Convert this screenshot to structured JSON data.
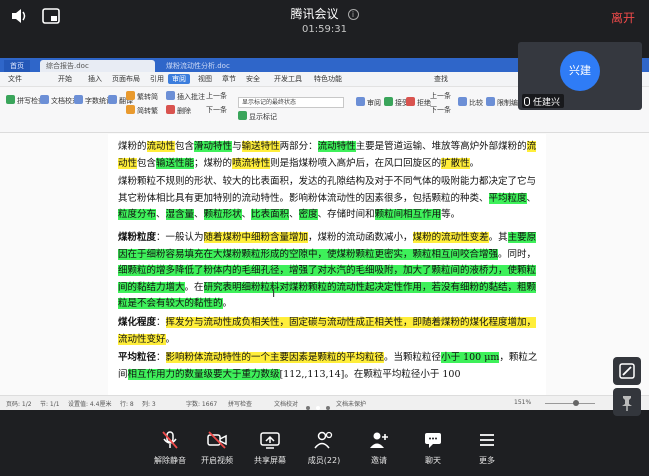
{
  "meeting": {
    "title": "腾讯会议",
    "timer": "01:59:31",
    "leave_label": "离开"
  },
  "wps": {
    "tabs": [
      "首页",
      "综合报告.doc",
      "煤粉流动性分析.doc"
    ],
    "menus": [
      "文件",
      "开始",
      "插入",
      "页面布局",
      "引用",
      "审阅",
      "视图",
      "章节",
      "安全",
      "开发工具",
      "特色功能",
      "查找"
    ],
    "active_menu": "审阅",
    "toolbar": {
      "spell_check": "拼写检查",
      "doc_proof": "文档校对",
      "word_count": "字数统计",
      "translate": "翻译",
      "trad_simp": "繁转简",
      "simp_trad": "简转繁",
      "insert_comment": "插入批注",
      "delete": "删除",
      "prev": "上一条",
      "next": "下一条",
      "revise": "修订",
      "markup_dropdown": "显示标记的最终状态",
      "show_markup": "显示标记",
      "reviewer": "审阅",
      "accept": "接受",
      "reject": "拒绝",
      "prev2": "上一条",
      "next2": "下一条",
      "compare": "比较",
      "limit_edit": "限制编辑",
      "doc_perm": "文档权限",
      "doc_auth": "文档认证"
    },
    "status": {
      "page": "页码: 1/2",
      "section": "节: 1/1",
      "setting": "设置值: 4.4厘米",
      "row": "行: 8",
      "col": "列: 3",
      "words": "字数: 1667",
      "spell": "拼写检查",
      "proof": "文档校对",
      "unsaved": "文档未保护",
      "zoom": "151%"
    }
  },
  "document": {
    "p1": [
      {
        "t": "煤粉的",
        "h": ""
      },
      {
        "t": "流动性",
        "h": "y"
      },
      {
        "t": "包含",
        "h": ""
      },
      {
        "t": "滑动特性",
        "h": "g"
      },
      {
        "t": "与",
        "h": ""
      },
      {
        "t": "输送特性",
        "h": "y"
      },
      {
        "t": "两部分：",
        "h": ""
      },
      {
        "t": "流动特性",
        "h": "g"
      },
      {
        "t": "主要是管道运输、堆放等高炉外部煤粉的",
        "h": ""
      },
      {
        "t": "流动性",
        "h": "y"
      },
      {
        "t": "包含",
        "h": ""
      },
      {
        "t": "输送性能",
        "h": "g"
      },
      {
        "t": "；煤粉的",
        "h": ""
      },
      {
        "t": "喷流特性",
        "h": "y"
      },
      {
        "t": "则是指煤粉喷入高炉后，在风口回旋区的",
        "h": ""
      },
      {
        "t": "扩散性",
        "h": "y"
      },
      {
        "t": "。",
        "h": ""
      }
    ],
    "p2": [
      {
        "t": "煤粉颗粒不规则的形状、较大的比表面积，发达的孔隙结构及对于不同气体的吸附能力都决定了它与其它粉体相比具有更加特别的流动特性。影响粉体流动性的因素很多，包括颗粒的种类、",
        "h": ""
      },
      {
        "t": "平均粒度",
        "h": "g"
      },
      {
        "t": "、",
        "h": ""
      },
      {
        "t": "粒度分布",
        "h": "g"
      },
      {
        "t": "、",
        "h": ""
      },
      {
        "t": "湿含量",
        "h": "g"
      },
      {
        "t": "、",
        "h": ""
      },
      {
        "t": "颗粒形状",
        "h": "g"
      },
      {
        "t": "、",
        "h": ""
      },
      {
        "t": "比表面积",
        "h": "g"
      },
      {
        "t": "、",
        "h": ""
      },
      {
        "t": "密度",
        "h": "g"
      },
      {
        "t": "、存储时间和",
        "h": ""
      },
      {
        "t": "颗粒间相互作用",
        "h": "g"
      },
      {
        "t": "等。",
        "h": ""
      }
    ],
    "p3": [
      {
        "t": "煤粉粒度",
        "h": "",
        "b": true
      },
      {
        "t": "：一般认为",
        "h": ""
      },
      {
        "t": "随着煤粉中细粉含量增加",
        "h": "y"
      },
      {
        "t": "，煤粉的流动函数减小，",
        "h": ""
      },
      {
        "t": "煤粉的流动性变差",
        "h": "y"
      },
      {
        "t": "。其",
        "h": ""
      },
      {
        "t": "主要原因在于细粉容易填充在大煤粉颗粒形成的空隙中，使煤粉颗粒更密实，颗粒相互间咬合增强",
        "h": "g"
      },
      {
        "t": "。同时，",
        "h": ""
      },
      {
        "t": "细颗粒的增多降低了粉体内的毛细孔径，增强了对水汽的毛细吸附，加大了颗粒间的液桥力，使颗粒间的黏结力增大",
        "h": "g"
      },
      {
        "t": "。在",
        "h": ""
      },
      {
        "t": "研究表明细粉粒料对煤粉颗粒的流动性起决定性作用，若没有细粉的黏结，粗颗粒是不会有较大的黏性的",
        "h": "g"
      },
      {
        "t": "。",
        "h": ""
      }
    ],
    "p4": [
      {
        "t": "煤化程度",
        "h": "",
        "b": true
      },
      {
        "t": "：",
        "h": ""
      },
      {
        "t": "挥发分与流动性成负相关性，固定碳与流动性成正相关性，即随着煤粉的煤化程度增加，流动性变好",
        "h": "y"
      },
      {
        "t": "。",
        "h": ""
      }
    ],
    "p5": [
      {
        "t": "平均粒径",
        "h": "",
        "b": true
      },
      {
        "t": "：",
        "h": ""
      },
      {
        "t": "影响粉体流动特性的一个主要因素是颗粒的平均粒径",
        "h": "y"
      },
      {
        "t": "。当颗粒粒径",
        "h": ""
      },
      {
        "t": "小于 100 μm",
        "h": "g"
      },
      {
        "t": "，颗粒之间",
        "h": ""
      },
      {
        "t": "相互作用力的数量级要大于重力数级",
        "h": "g"
      },
      {
        "t": "[112,,113,14]。在颗粒平均粒径小于 100",
        "h": ""
      }
    ]
  },
  "participant": {
    "avatar_text": "兴建",
    "name": "任建兴"
  },
  "bottom": {
    "mute": "解除静音",
    "video": "开启视频",
    "share": "共享屏幕",
    "members": "成员(22)",
    "invite": "邀请",
    "chat": "聊天",
    "more": "更多"
  },
  "colors": {
    "leave": "#f04a4a",
    "highlight_yellow": "#ffee3a",
    "highlight_green": "#3ef05a",
    "avatar": "#2f7cf6",
    "wps_blue": "#2f66c9"
  }
}
